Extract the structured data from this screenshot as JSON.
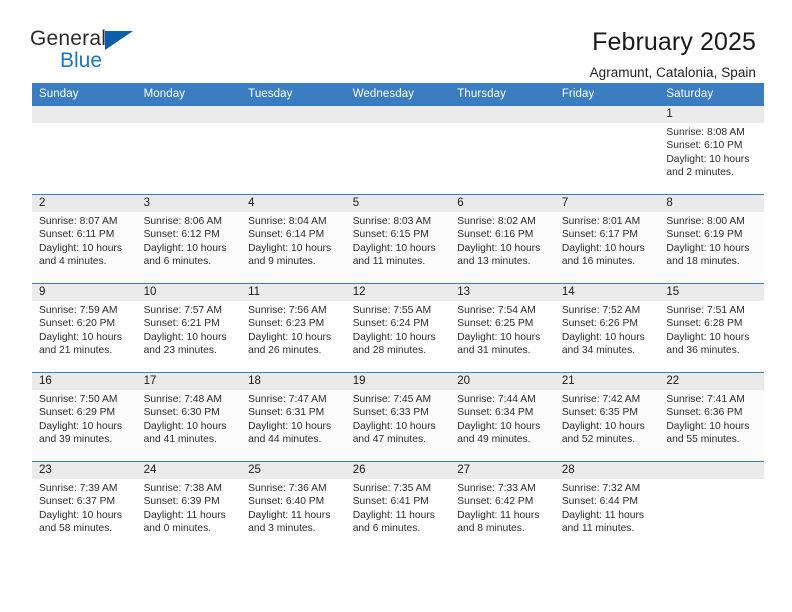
{
  "brand": {
    "name_part1": "General",
    "name_part2": "Blue",
    "logo_icon": "triangle-flag-icon"
  },
  "header": {
    "month_title": "February 2025",
    "location": "Agramunt, Catalonia, Spain"
  },
  "calendar": {
    "accent_color": "#3a7dc0",
    "daynum_band_color": "#ebebeb",
    "weekday_headers": [
      "Sunday",
      "Monday",
      "Tuesday",
      "Wednesday",
      "Thursday",
      "Friday",
      "Saturday"
    ],
    "weeks": [
      [
        {
          "empty": true
        },
        {
          "empty": true
        },
        {
          "empty": true
        },
        {
          "empty": true
        },
        {
          "empty": true
        },
        {
          "empty": true
        },
        {
          "day": "1",
          "sunrise": "Sunrise: 8:08 AM",
          "sunset": "Sunset: 6:10 PM",
          "daylight": "Daylight: 10 hours and 2 minutes."
        }
      ],
      [
        {
          "day": "2",
          "sunrise": "Sunrise: 8:07 AM",
          "sunset": "Sunset: 6:11 PM",
          "daylight": "Daylight: 10 hours and 4 minutes."
        },
        {
          "day": "3",
          "sunrise": "Sunrise: 8:06 AM",
          "sunset": "Sunset: 6:12 PM",
          "daylight": "Daylight: 10 hours and 6 minutes."
        },
        {
          "day": "4",
          "sunrise": "Sunrise: 8:04 AM",
          "sunset": "Sunset: 6:14 PM",
          "daylight": "Daylight: 10 hours and 9 minutes."
        },
        {
          "day": "5",
          "sunrise": "Sunrise: 8:03 AM",
          "sunset": "Sunset: 6:15 PM",
          "daylight": "Daylight: 10 hours and 11 minutes."
        },
        {
          "day": "6",
          "sunrise": "Sunrise: 8:02 AM",
          "sunset": "Sunset: 6:16 PM",
          "daylight": "Daylight: 10 hours and 13 minutes."
        },
        {
          "day": "7",
          "sunrise": "Sunrise: 8:01 AM",
          "sunset": "Sunset: 6:17 PM",
          "daylight": "Daylight: 10 hours and 16 minutes."
        },
        {
          "day": "8",
          "sunrise": "Sunrise: 8:00 AM",
          "sunset": "Sunset: 6:19 PM",
          "daylight": "Daylight: 10 hours and 18 minutes."
        }
      ],
      [
        {
          "day": "9",
          "sunrise": "Sunrise: 7:59 AM",
          "sunset": "Sunset: 6:20 PM",
          "daylight": "Daylight: 10 hours and 21 minutes."
        },
        {
          "day": "10",
          "sunrise": "Sunrise: 7:57 AM",
          "sunset": "Sunset: 6:21 PM",
          "daylight": "Daylight: 10 hours and 23 minutes."
        },
        {
          "day": "11",
          "sunrise": "Sunrise: 7:56 AM",
          "sunset": "Sunset: 6:23 PM",
          "daylight": "Daylight: 10 hours and 26 minutes."
        },
        {
          "day": "12",
          "sunrise": "Sunrise: 7:55 AM",
          "sunset": "Sunset: 6:24 PM",
          "daylight": "Daylight: 10 hours and 28 minutes."
        },
        {
          "day": "13",
          "sunrise": "Sunrise: 7:54 AM",
          "sunset": "Sunset: 6:25 PM",
          "daylight": "Daylight: 10 hours and 31 minutes."
        },
        {
          "day": "14",
          "sunrise": "Sunrise: 7:52 AM",
          "sunset": "Sunset: 6:26 PM",
          "daylight": "Daylight: 10 hours and 34 minutes."
        },
        {
          "day": "15",
          "sunrise": "Sunrise: 7:51 AM",
          "sunset": "Sunset: 6:28 PM",
          "daylight": "Daylight: 10 hours and 36 minutes."
        }
      ],
      [
        {
          "day": "16",
          "sunrise": "Sunrise: 7:50 AM",
          "sunset": "Sunset: 6:29 PM",
          "daylight": "Daylight: 10 hours and 39 minutes."
        },
        {
          "day": "17",
          "sunrise": "Sunrise: 7:48 AM",
          "sunset": "Sunset: 6:30 PM",
          "daylight": "Daylight: 10 hours and 41 minutes."
        },
        {
          "day": "18",
          "sunrise": "Sunrise: 7:47 AM",
          "sunset": "Sunset: 6:31 PM",
          "daylight": "Daylight: 10 hours and 44 minutes."
        },
        {
          "day": "19",
          "sunrise": "Sunrise: 7:45 AM",
          "sunset": "Sunset: 6:33 PM",
          "daylight": "Daylight: 10 hours and 47 minutes."
        },
        {
          "day": "20",
          "sunrise": "Sunrise: 7:44 AM",
          "sunset": "Sunset: 6:34 PM",
          "daylight": "Daylight: 10 hours and 49 minutes."
        },
        {
          "day": "21",
          "sunrise": "Sunrise: 7:42 AM",
          "sunset": "Sunset: 6:35 PM",
          "daylight": "Daylight: 10 hours and 52 minutes."
        },
        {
          "day": "22",
          "sunrise": "Sunrise: 7:41 AM",
          "sunset": "Sunset: 6:36 PM",
          "daylight": "Daylight: 10 hours and 55 minutes."
        }
      ],
      [
        {
          "day": "23",
          "sunrise": "Sunrise: 7:39 AM",
          "sunset": "Sunset: 6:37 PM",
          "daylight": "Daylight: 10 hours and 58 minutes."
        },
        {
          "day": "24",
          "sunrise": "Sunrise: 7:38 AM",
          "sunset": "Sunset: 6:39 PM",
          "daylight": "Daylight: 11 hours and 0 minutes."
        },
        {
          "day": "25",
          "sunrise": "Sunrise: 7:36 AM",
          "sunset": "Sunset: 6:40 PM",
          "daylight": "Daylight: 11 hours and 3 minutes."
        },
        {
          "day": "26",
          "sunrise": "Sunrise: 7:35 AM",
          "sunset": "Sunset: 6:41 PM",
          "daylight": "Daylight: 11 hours and 6 minutes."
        },
        {
          "day": "27",
          "sunrise": "Sunrise: 7:33 AM",
          "sunset": "Sunset: 6:42 PM",
          "daylight": "Daylight: 11 hours and 8 minutes."
        },
        {
          "day": "28",
          "sunrise": "Sunrise: 7:32 AM",
          "sunset": "Sunset: 6:44 PM",
          "daylight": "Daylight: 11 hours and 11 minutes."
        },
        {
          "empty": true
        }
      ]
    ]
  }
}
